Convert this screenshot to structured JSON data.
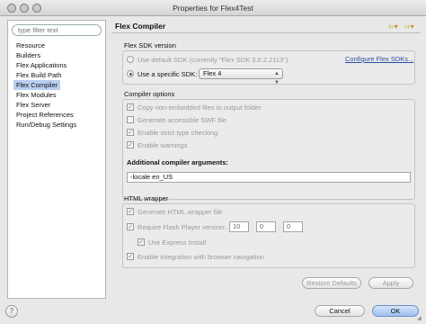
{
  "window": {
    "title": "Properties for Flex4Test"
  },
  "sidebar": {
    "search_placeholder": "type filter text",
    "items": [
      {
        "label": "Resource"
      },
      {
        "label": "Builders"
      },
      {
        "label": "Flex Applications"
      },
      {
        "label": "Flex Build Path"
      },
      {
        "label": "Flex Compiler",
        "selected": true
      },
      {
        "label": "Flex Modules"
      },
      {
        "label": "Flex Server"
      },
      {
        "label": "Project References"
      },
      {
        "label": "Run/Debug Settings"
      }
    ]
  },
  "page": {
    "title": "Flex Compiler",
    "back_icon": "back-arrow-icon",
    "forward_icon": "forward-arrow-icon"
  },
  "sdk": {
    "section_label": "Flex SDK version",
    "use_default_label": "Use default SDK (currently \"Flex SDK 3.0.2.2113\")",
    "use_specific_label": "Use a specific SDK:",
    "specific_value": "Flex 4",
    "configure_link": "Configure Flex SDKs..."
  },
  "compiler": {
    "section_label": "Compiler options",
    "options": [
      {
        "label": "Copy non-embedded files to output folder",
        "checked": true
      },
      {
        "label": "Generate accessible SWF file",
        "checked": false
      },
      {
        "label": "Enable strict type checking",
        "checked": true
      },
      {
        "label": "Enable warnings",
        "checked": true
      }
    ],
    "additional_label": "Additional compiler arguments:",
    "additional_value": "-locale en_US"
  },
  "html": {
    "section_label": "HTML wrapper",
    "generate_label": "Generate HTML wrapper file",
    "require_label": "Require Flash Player version:",
    "version": [
      "10",
      "0",
      "0"
    ],
    "express_label": "Use Express Install",
    "navigation_label": "Enable integration with browser navigation"
  },
  "buttons": {
    "restore": "Restore Defaults",
    "apply": "Apply",
    "cancel": "Cancel",
    "ok": "OK",
    "help": "?"
  }
}
